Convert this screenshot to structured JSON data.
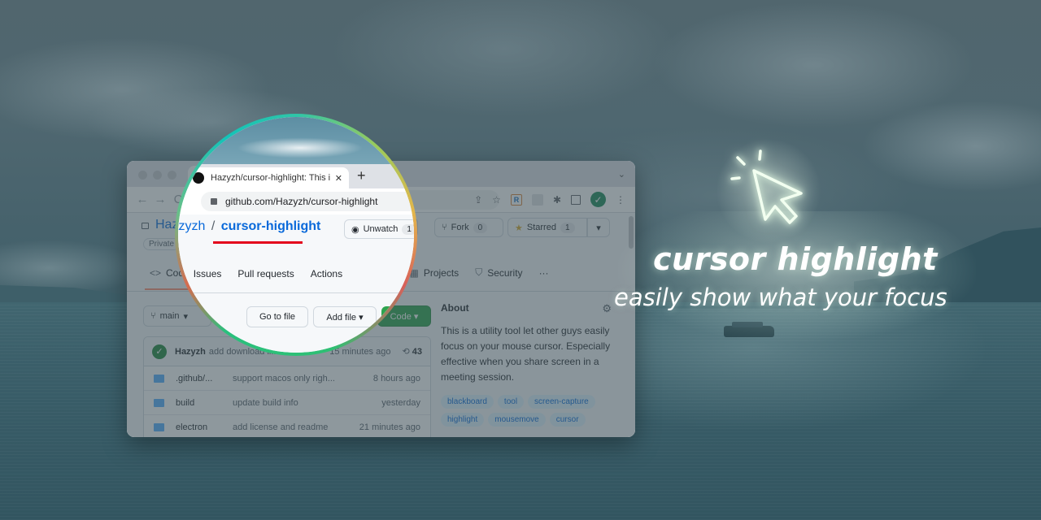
{
  "colors": {
    "accent_link": "#0969da",
    "underline_mark": "#e3001b",
    "code_button": "#2da44e",
    "lens_ring": [
      "#2ec5a8",
      "#e3b64b",
      "#d8605a",
      "#2fbf73"
    ]
  },
  "browser": {
    "tab_title": "Hazyzh/cursor-highlight: This i",
    "tab_close": "✕",
    "new_tab": "+",
    "url_domain": "github.com",
    "url_path": "/Hazyzh/cursor-highlight",
    "nav": {
      "back": "←",
      "forward": "→",
      "reload": "C"
    },
    "toolbar_icons": [
      "share-icon",
      "bookmark-star-icon",
      "extension-r-icon",
      "extension-blank-icon",
      "extensions-puzzle-icon",
      "side-panel-icon",
      "profile-check-icon",
      "menu-kebab-icon"
    ]
  },
  "repo": {
    "owner": "Hazyzh",
    "separator": "/",
    "name": "cursor-highlight",
    "visibility": "Private",
    "watch": {
      "label": "Unwatch",
      "count": "1"
    },
    "fork": {
      "label": "Fork",
      "count": "0"
    },
    "star": {
      "label": "Starred",
      "count": "1"
    },
    "tabs": [
      {
        "icon": "<>",
        "label": "Code",
        "active": true
      },
      {
        "icon": "⊙",
        "label": "Issues"
      },
      {
        "icon": "⇅",
        "label": "Pull requests"
      },
      {
        "icon": "▷",
        "label": "Actions"
      },
      {
        "icon": "▦",
        "label": "Projects"
      },
      {
        "icon": "⛉",
        "label": "Security"
      },
      {
        "icon": "",
        "label": "···"
      }
    ],
    "branch": "main",
    "go_to_file": "Go to file",
    "add_file": "Add file ▾",
    "code_button": "Code ▾",
    "latest_commit": {
      "author": "Hazyzh",
      "message": "add download li...",
      "time": "15 minutes ago",
      "commit_count": "43"
    },
    "files": [
      {
        "name": ".github/...",
        "commit": "support macos only righ...",
        "time": "8 hours ago"
      },
      {
        "name": "build",
        "commit": "update build info",
        "time": "yesterday"
      },
      {
        "name": "electron",
        "commit": "add license and readme",
        "time": "21 minutes ago"
      }
    ],
    "about": {
      "title": "About",
      "description": "This is a utility tool let other guys easily focus on your mouse cursor. Especially effective when you share screen in a meeting session.",
      "topics": [
        "blackboard",
        "tool",
        "screen-capture",
        "highlight",
        "mousemove",
        "cursor"
      ]
    }
  },
  "promo": {
    "headline": "cursor highlight",
    "subline": "easily show what your focus"
  }
}
